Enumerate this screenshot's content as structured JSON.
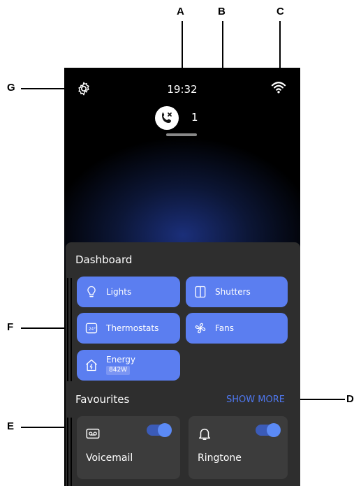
{
  "callouts": {
    "a": "A",
    "b": "B",
    "c": "C",
    "d": "D",
    "e": "E",
    "f": "F",
    "g": "G"
  },
  "status": {
    "time": "19:32",
    "missed_calls": "1"
  },
  "dashboard": {
    "title": "Dashboard",
    "tiles": [
      {
        "label": "Lights",
        "icon": "lightbulb-icon"
      },
      {
        "label": "Shutters",
        "icon": "shutters-icon"
      },
      {
        "label": "Thermostats",
        "icon": "thermostat-icon"
      },
      {
        "label": "Fans",
        "icon": "fan-icon"
      },
      {
        "label": "Energy",
        "value": "842W",
        "icon": "energy-house-icon"
      }
    ]
  },
  "favourites": {
    "title": "Favourites",
    "show_more": "SHOW MORE",
    "items": [
      {
        "label": "Voicemail",
        "icon": "voicemail-icon",
        "enabled": true
      },
      {
        "label": "Ringtone",
        "icon": "bell-icon",
        "enabled": true
      }
    ]
  },
  "colors": {
    "tile": "#5b7ef0",
    "accent": "#4f78f0",
    "panel": "#2e2e2e",
    "card": "#3c3c3c"
  }
}
